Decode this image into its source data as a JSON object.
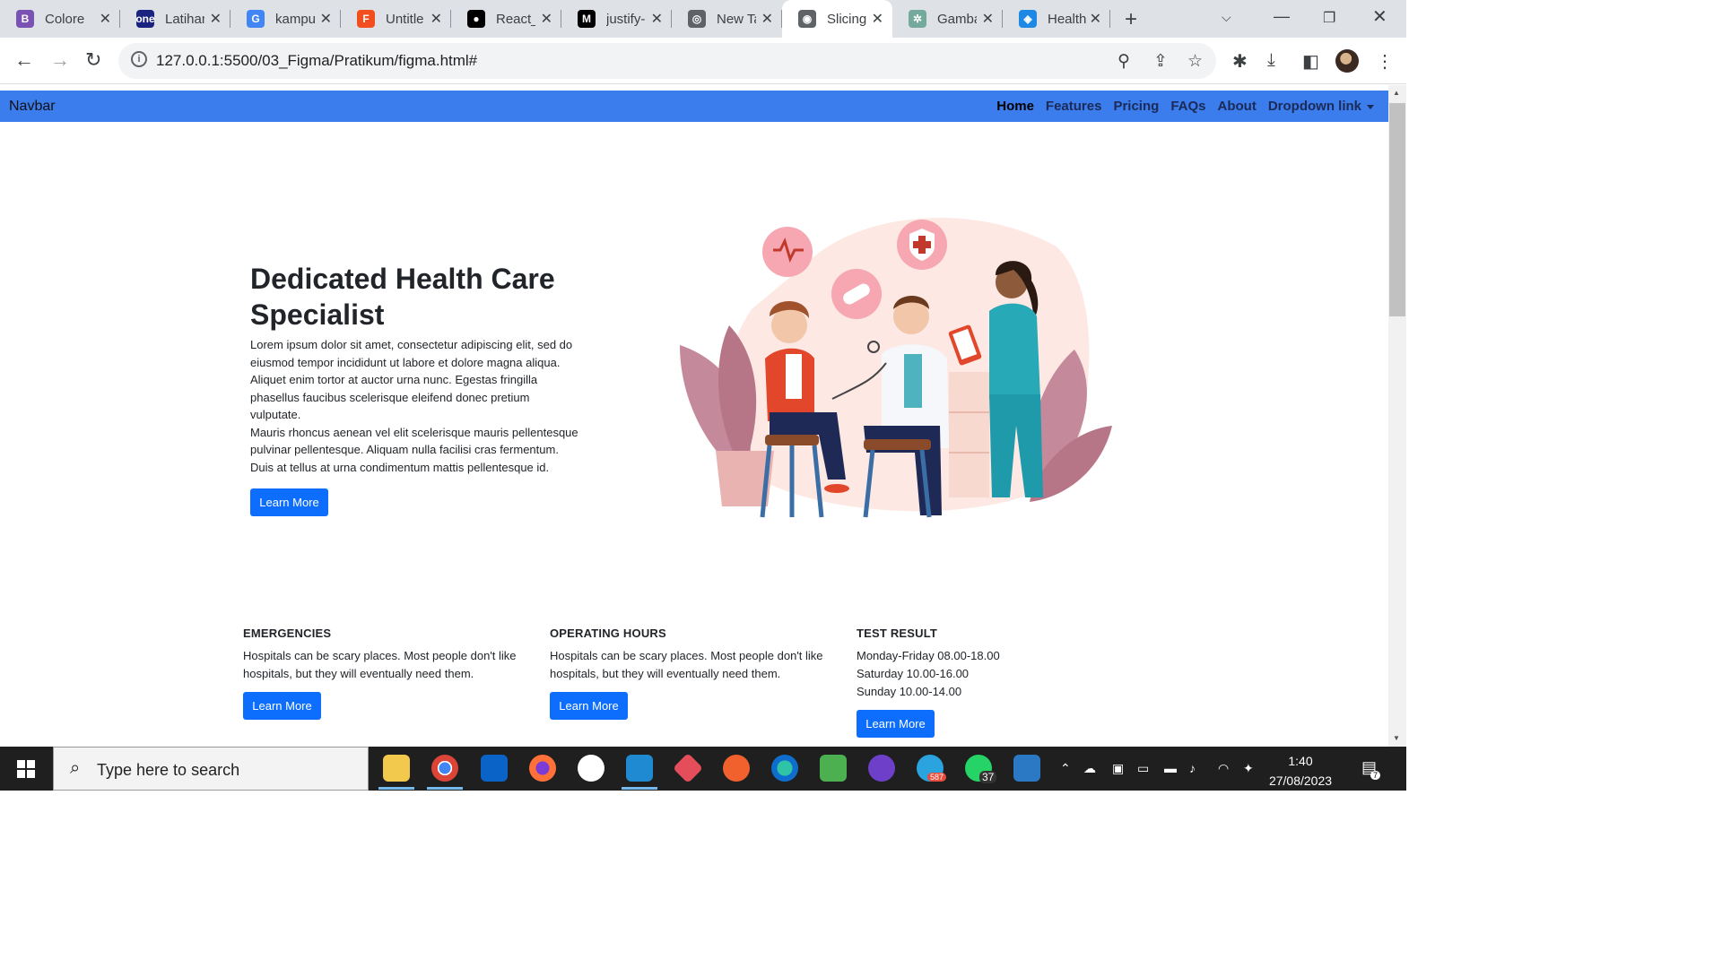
{
  "browser": {
    "tabs": [
      {
        "title": "Colore",
        "favicon": "bootstrap-icon",
        "color": "#7952b3",
        "glyph": "B"
      },
      {
        "title": "Latihan",
        "favicon": "one-icon",
        "color": "#1a237e",
        "glyph": "one"
      },
      {
        "title": "kampu",
        "favicon": "google-icon",
        "color": "#4285f4",
        "glyph": "G"
      },
      {
        "title": "Untitle",
        "favicon": "figma-icon",
        "color": "#f24e1e",
        "glyph": "F"
      },
      {
        "title": "React_",
        "favicon": "github-icon",
        "color": "#000000",
        "glyph": "●"
      },
      {
        "title": "justify-",
        "favicon": "m-icon",
        "color": "#000000",
        "glyph": "M"
      },
      {
        "title": "New Ta",
        "favicon": "chrome-icon",
        "color": "#5f6368",
        "glyph": "◎"
      },
      {
        "title": "Slicing",
        "favicon": "globe-icon",
        "color": "#5f6368",
        "glyph": "◉",
        "active": true
      },
      {
        "title": "Gamba",
        "favicon": "chatgpt-icon",
        "color": "#74aa9c",
        "glyph": "✲"
      },
      {
        "title": "Health",
        "favicon": "logo-icon",
        "color": "#1e88e5",
        "glyph": "◈"
      }
    ],
    "url": "127.0.0.1:5500/03_Figma/Pratikum/figma.html#"
  },
  "page": {
    "navbar": {
      "brand": "Navbar",
      "links": [
        "Home",
        "Features",
        "Pricing",
        "FAQs",
        "About",
        "Dropdown link"
      ]
    },
    "hero": {
      "title": "Dedicated Health Care Specialist",
      "paragraph_1": "Lorem ipsum dolor sit amet, consectetur adipiscing elit, sed do eiusmod tempor incididunt ut labore et dolore magna aliqua. Aliquet enim tortor at auctor urna nunc. Egestas fringilla phasellus faucibus scelerisque eleifend donec pretium vulputate.",
      "paragraph_2": "Mauris rhoncus aenean vel elit scelerisque mauris pellentesque pulvinar pellentesque. Aliquam nulla facilisi cras fermentum. Duis at tellus at urna condimentum mattis pellentesque id.",
      "button": "Learn More"
    },
    "features": [
      {
        "heading": "EMERGENCIES",
        "lines": [
          "Hospitals can be scary places. Most people don't like hospitals, but they will eventually need them."
        ],
        "button": "Learn More"
      },
      {
        "heading": "OPERATING HOURS",
        "lines": [
          "Hospitals can be scary places. Most people don't like hospitals, but they will eventually need them."
        ],
        "button": "Learn More"
      },
      {
        "heading": "TEST RESULT",
        "lines": [
          "Monday-Friday 08.00-18.00",
          "Saturday 10.00-16.00",
          "Sunday 10.00-14.00"
        ],
        "button": "Learn More"
      }
    ]
  },
  "taskbar": {
    "search_placeholder": "Type here to search",
    "time": "1:40",
    "date": "27/08/2023",
    "telegram_badge": "587",
    "whatsapp_badge": "37",
    "notification_badge": "7"
  }
}
